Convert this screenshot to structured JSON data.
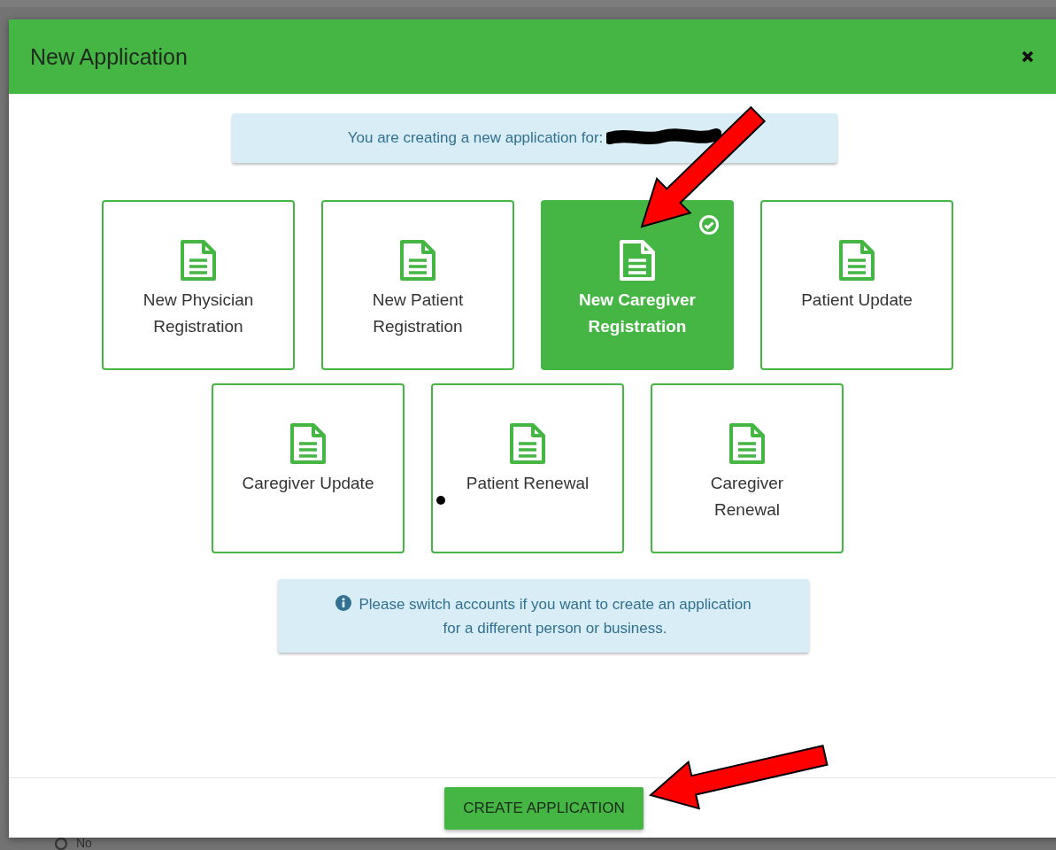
{
  "dialog": {
    "title": "New Application",
    "notice": "You are creating a new application for:",
    "options": [
      {
        "label": "New Physician\nRegistration",
        "selected": false
      },
      {
        "label": "New Patient\nRegistration",
        "selected": false
      },
      {
        "label": "New Caregiver\nRegistration",
        "selected": true
      },
      {
        "label": "Patient Update",
        "selected": false
      },
      {
        "label": "Caregiver Update",
        "selected": false
      },
      {
        "label": "Patient Renewal",
        "selected": false
      },
      {
        "label": "Caregiver\nRenewal",
        "selected": false
      }
    ],
    "hint": "Please switch accounts if you want to create an application\nfor a different person or business.",
    "submit": "CREATE APPLICATION"
  },
  "background_form": {
    "option": {
      "label": "No",
      "selected": false
    }
  }
}
